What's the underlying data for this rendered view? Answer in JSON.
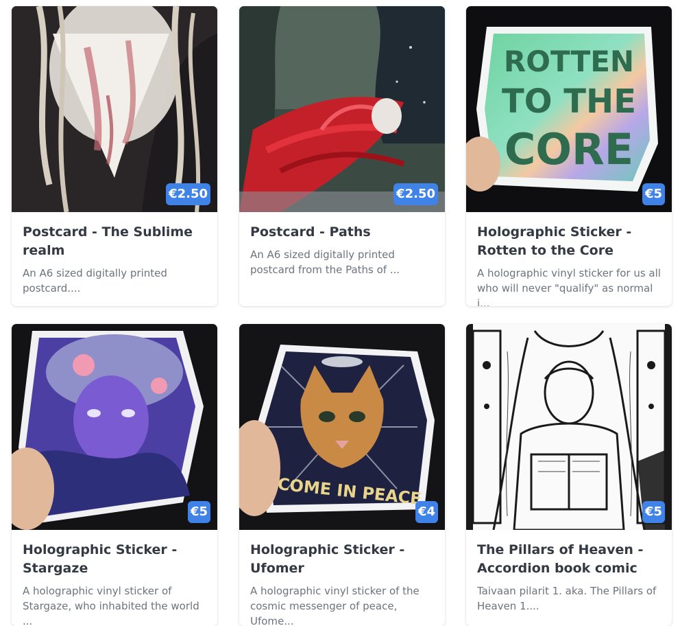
{
  "products": [
    {
      "title": "Postcard - The Sublime realm",
      "description": "An A6 sized digitally printed postcard....",
      "price": "€2.50",
      "image_icon": "artwork-pale-winged-figure-image"
    },
    {
      "title": "Postcard - Paths",
      "description": "An A6 sized digitally printed postcard from the Paths of ...",
      "price": "€2.50",
      "image_icon": "artwork-red-haired-figure-in-forest-image"
    },
    {
      "title": "Holographic Sticker - Rotten to the Core",
      "description": "A holographic vinyl sticker for us all who will never \"qualify\" as normal i...",
      "price": "€5",
      "image_icon": "sticker-rotten-to-the-core-image",
      "image_text": [
        "ROTTEN",
        "TO THE",
        "CORE"
      ]
    },
    {
      "title": "Holographic Sticker - Stargaze",
      "description": "A holographic vinyl sticker of Stargaze, who inhabited the world ...",
      "price": "€5",
      "image_icon": "sticker-stargaze-purple-figure-image"
    },
    {
      "title": "Holographic Sticker - Ufomer",
      "description": "A holographic vinyl sticker of the cosmic messenger of peace, Ufome...",
      "price": "€4",
      "image_icon": "sticker-ufo-cat-image",
      "image_text": [
        "COME IN PEACE"
      ]
    },
    {
      "title": "The Pillars of Heaven - Accordion book comic",
      "description": "Taivaan pilarit 1. aka. The Pillars of Heaven 1....",
      "price": "€5",
      "image_icon": "artwork-lineart-figure-reading-book-image"
    }
  ],
  "colors": {
    "price_badge": "#3f83e8",
    "title_text": "#333a43",
    "description_text": "#6c737d"
  }
}
